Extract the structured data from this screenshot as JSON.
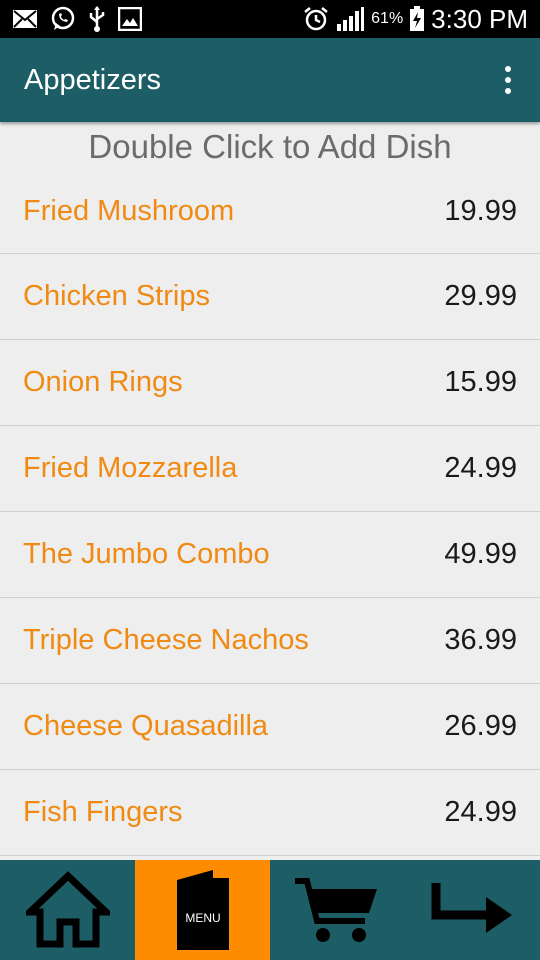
{
  "status_bar": {
    "battery": "61%",
    "time": "3:30 PM"
  },
  "app_bar": {
    "title": "Appetizers"
  },
  "instruction": "Double Click to Add Dish",
  "menu_items": [
    {
      "name": "Fried Mushroom",
      "price": "19.99"
    },
    {
      "name": "Chicken Strips",
      "price": "29.99"
    },
    {
      "name": "Onion Rings",
      "price": "15.99"
    },
    {
      "name": "Fried Mozzarella",
      "price": "24.99"
    },
    {
      "name": "The Jumbo Combo",
      "price": "49.99"
    },
    {
      "name": "Triple Cheese Nachos",
      "price": "36.99"
    },
    {
      "name": "Cheese Quasadilla",
      "price": "26.99"
    },
    {
      "name": "Fish Fingers",
      "price": "24.99"
    }
  ],
  "bottom_nav": {
    "home_icon": "home-icon",
    "menu_label": "MENU",
    "cart_icon": "cart-icon",
    "exit_icon": "arrow-icon"
  },
  "colors": {
    "primary": "#1d5e66",
    "accent": "#ff8c00",
    "item_name": "#f08a13"
  }
}
